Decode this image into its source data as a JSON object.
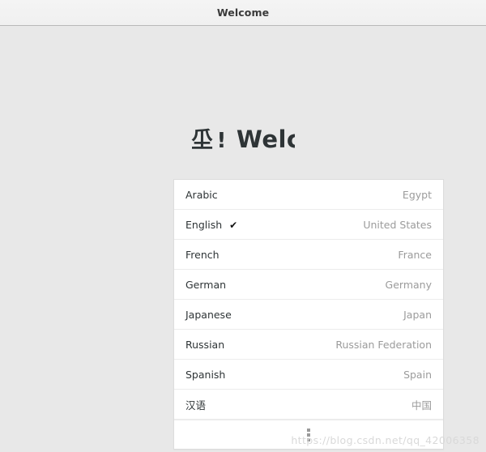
{
  "window": {
    "title": "Welcome"
  },
  "headline": {
    "cjk_glyph": "坕",
    "exclamation": "!",
    "latin_text": "Welcome",
    "visible_fragment": "Welc"
  },
  "language_list": {
    "rows": [
      {
        "language": "Arabic",
        "region": "Egypt",
        "selected": false,
        "check": ""
      },
      {
        "language": "English",
        "region": "United States",
        "selected": true,
        "check": "✔"
      },
      {
        "language": "French",
        "region": "France",
        "selected": false,
        "check": ""
      },
      {
        "language": "German",
        "region": "Germany",
        "selected": false,
        "check": ""
      },
      {
        "language": "Japanese",
        "region": "Japan",
        "selected": false,
        "check": ""
      },
      {
        "language": "Russian",
        "region": "Russian Federation",
        "selected": false,
        "check": ""
      },
      {
        "language": "Spanish",
        "region": "Spain",
        "selected": false,
        "check": ""
      },
      {
        "language": "汉语",
        "region": "中国",
        "selected": false,
        "check": ""
      }
    ],
    "more_icon": "vertical-ellipsis"
  },
  "watermark": {
    "text": "https://blog.csdn.net/qq_42006358"
  },
  "colors": {
    "titlebar_bg": "#f2f2f2",
    "page_bg": "#e8e8e8",
    "card_bg": "#ffffff",
    "card_border": "#dcdcdc",
    "text_primary": "#2e3436",
    "text_secondary": "#9b9b9b"
  }
}
